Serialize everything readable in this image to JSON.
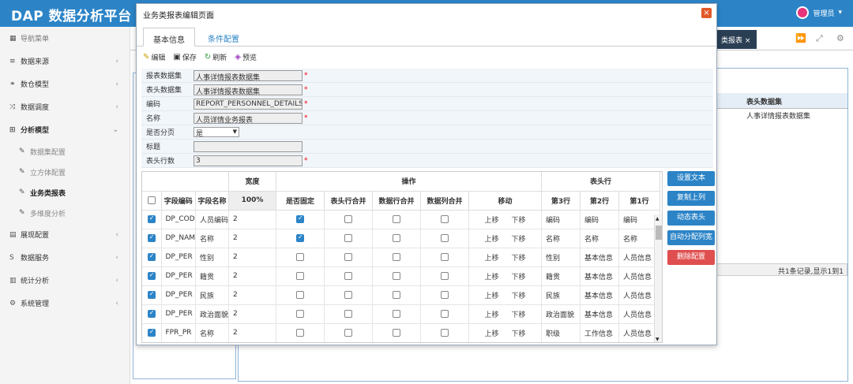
{
  "app": {
    "brand": "DAP 数据分析平台",
    "user": "管理员"
  },
  "sidebar": {
    "header": "导航菜单",
    "items": [
      {
        "label": "数据来源",
        "icon": "database-icon"
      },
      {
        "label": "数仓模型",
        "icon": "model-icon"
      },
      {
        "label": "数据调度",
        "icon": "shuffle-icon"
      },
      {
        "label": "分析模型",
        "icon": "analysis-icon"
      }
    ],
    "subitems": [
      "数据集配置",
      "立方体配置",
      "业务类报表",
      "多维度分析"
    ],
    "items2": [
      {
        "label": "展现配置",
        "icon": "display-icon"
      },
      {
        "label": "数据服务",
        "icon": "service-icon"
      },
      {
        "label": "统计分析",
        "icon": "stats-icon"
      },
      {
        "label": "系统管理",
        "icon": "gear-icon"
      }
    ]
  },
  "tabs": {
    "active_tab": "类报表 ×"
  },
  "background": {
    "column_header": "表头数据集",
    "cell": "人事详情报表数据集",
    "pager": "共1条记录,显示1到1"
  },
  "modal": {
    "title": "业务类报表编辑页面",
    "tabs": [
      "基本信息",
      "条件配置"
    ],
    "toolbar": [
      "编辑",
      "保存",
      "刷新",
      "预览"
    ],
    "form": {
      "report_dataset_label": "报表数据集",
      "report_dataset": "人事详情报表数据集",
      "header_dataset_label": "表头数据集",
      "header_dataset": "人事详情报表数据集",
      "code_label": "编码",
      "code": "REPORT_PERSONNEL_DETAILS",
      "name_label": "名称",
      "name": "人员详情业务报表",
      "paging_label": "是否分页",
      "paging": "是",
      "title_label": "标题",
      "title": "",
      "header_rows_label": "表头行数",
      "header_rows": "3"
    },
    "grid": {
      "headers": {
        "width": "宽度",
        "ops": "操作",
        "header_row": "表头行",
        "field_code": "字段编码",
        "field_name": "字段名称",
        "pct": "100%",
        "fixed": "是否固定",
        "header_merge": "表头行合并",
        "data_row_merge": "数据行合并",
        "data_col_merge": "数据列合并",
        "move": "移动",
        "row3": "第3行",
        "row2": "第2行",
        "row1": "第1行"
      },
      "move_up": "上移",
      "move_down": "下移",
      "rows": [
        {
          "code": "DP_COD",
          "name": "人员编码",
          "width": "2",
          "fixed": true,
          "r3": "编码",
          "r2": "编码",
          "r1": "编码"
        },
        {
          "code": "DP_NAM",
          "name": "名称",
          "width": "2",
          "fixed": true,
          "r3": "名称",
          "r2": "名称",
          "r1": "名称"
        },
        {
          "code": "DP_PER",
          "name": "性别",
          "width": "2",
          "fixed": false,
          "r3": "性别",
          "r2": "基本信息",
          "r1": "人员信息"
        },
        {
          "code": "DP_PER",
          "name": "籍贯",
          "width": "2",
          "fixed": false,
          "r3": "籍贯",
          "r2": "基本信息",
          "r1": "人员信息"
        },
        {
          "code": "DP_PER",
          "name": "民族",
          "width": "2",
          "fixed": false,
          "r3": "民族",
          "r2": "基本信息",
          "r1": "人员信息"
        },
        {
          "code": "DP_PER",
          "name": "政治面貌",
          "width": "2",
          "fixed": false,
          "r3": "政治面貌",
          "r2": "基本信息",
          "r1": "人员信息"
        },
        {
          "code": "FPR_PR",
          "name": "名称",
          "width": "2",
          "fixed": false,
          "r3": "职级",
          "r2": "工作信息",
          "r1": "人员信息"
        }
      ]
    },
    "buttons": [
      "设置文本",
      "复制上列",
      "动态表头",
      "自动分配列宽",
      "删除配置"
    ]
  }
}
